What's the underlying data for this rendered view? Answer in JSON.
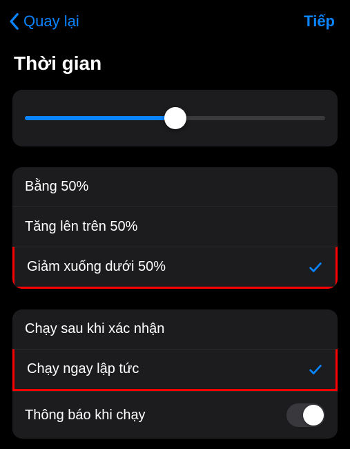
{
  "nav": {
    "back": "Quay lại",
    "next": "Tiếp"
  },
  "title": "Thời gian",
  "slider": {
    "percent": 50
  },
  "options": [
    {
      "label": "Bằng 50%",
      "selected": false
    },
    {
      "label": "Tăng lên trên 50%",
      "selected": false
    },
    {
      "label": "Giảm xuống dưới 50%",
      "selected": true
    }
  ],
  "run": [
    {
      "label": "Chạy sau khi xác nhận",
      "selected": false
    },
    {
      "label": "Chạy ngay lập tức",
      "selected": true
    }
  ],
  "notify": {
    "label": "Thông báo khi chạy",
    "on": false
  }
}
